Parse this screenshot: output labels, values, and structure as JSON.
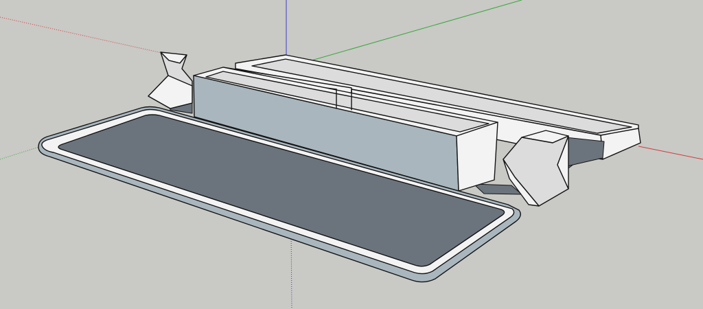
{
  "viewport": {
    "background_color": "#c9c9c5"
  },
  "axes": {
    "red_color": "#d23a3a",
    "green_color": "#35a83a",
    "blue_color": "#3a3ad0"
  },
  "materials": {
    "face_light": "#f3f3f3",
    "face_mid": "#dcdcdc",
    "face_blue": "#a9b6be",
    "face_dark": "#6b747d",
    "edge": "#141414"
  },
  "model": {
    "objects": [
      "lid",
      "tray",
      "rear-box",
      "front-box",
      "left-hinge",
      "right-hinge"
    ]
  }
}
